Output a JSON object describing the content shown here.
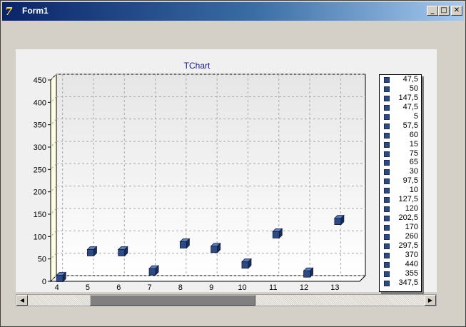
{
  "window": {
    "title": "Form1",
    "minimize": "_",
    "maximize": "□",
    "close": "✕",
    "icon": "delphi-app-icon"
  },
  "chart": {
    "title": "TChart"
  },
  "chart_data": {
    "type": "bar",
    "title": "TChart",
    "xlabel": "",
    "ylabel": "",
    "ylim": [
      0,
      450
    ],
    "x_ticks": [
      4,
      5,
      6,
      7,
      8,
      9,
      10,
      11,
      12,
      13
    ],
    "y_ticks": [
      0,
      50,
      100,
      150,
      200,
      250,
      300,
      350,
      400,
      450
    ],
    "points": [
      {
        "x": 4,
        "y": 0
      },
      {
        "x": 5,
        "y": 57.5
      },
      {
        "x": 6,
        "y": 57.5
      },
      {
        "x": 7,
        "y": 15
      },
      {
        "x": 8,
        "y": 75
      },
      {
        "x": 9,
        "y": 65
      },
      {
        "x": 10,
        "y": 30
      },
      {
        "x": 11,
        "y": 97.5
      },
      {
        "x": 12,
        "y": 10
      },
      {
        "x": 13,
        "y": 127.5
      }
    ],
    "grid": true,
    "legend_position": "right",
    "color": "#2d4a85"
  },
  "legend": {
    "items": [
      "47,5",
      "50",
      "147,5",
      "47,5",
      "5",
      "57,5",
      "60",
      "15",
      "75",
      "65",
      "30",
      "97,5",
      "10",
      "127,5",
      "120",
      "202,5",
      "170",
      "260",
      "297,5",
      "370",
      "440",
      "355",
      "347,5"
    ]
  },
  "scrollbar": {
    "left_arrow": "◀",
    "right_arrow": "▶"
  }
}
